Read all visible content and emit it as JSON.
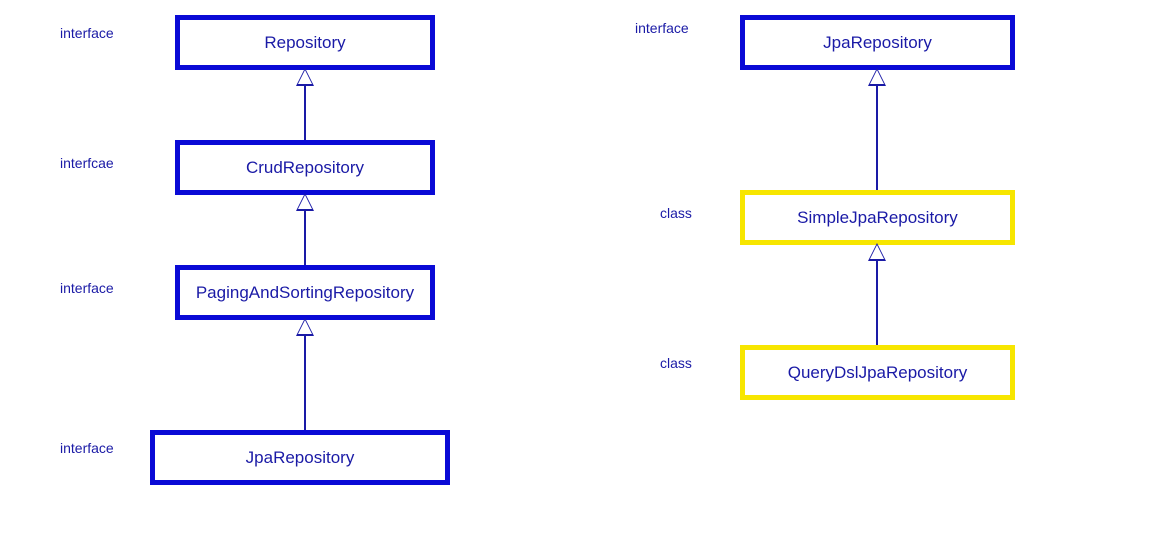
{
  "left": {
    "stereotypes": [
      "interface",
      "interfcae",
      "interface",
      "interface"
    ],
    "boxes": [
      {
        "name": "Repository"
      },
      {
        "name": "CrudRepository"
      },
      {
        "name": "PagingAndSortingRepository"
      },
      {
        "name": "JpaRepository"
      }
    ]
  },
  "right": {
    "stereotypes": [
      "interface",
      "class",
      "class"
    ],
    "boxes": [
      {
        "name": "JpaRepository",
        "type": "interface"
      },
      {
        "name": "SimpleJpaRepository",
        "type": "class"
      },
      {
        "name": "QueryDslJpaRepository",
        "type": "class"
      }
    ]
  },
  "colors": {
    "interfaceBorder": "#0a0ad6",
    "classBorder": "#f7e600",
    "text": "#1a1aa6"
  }
}
